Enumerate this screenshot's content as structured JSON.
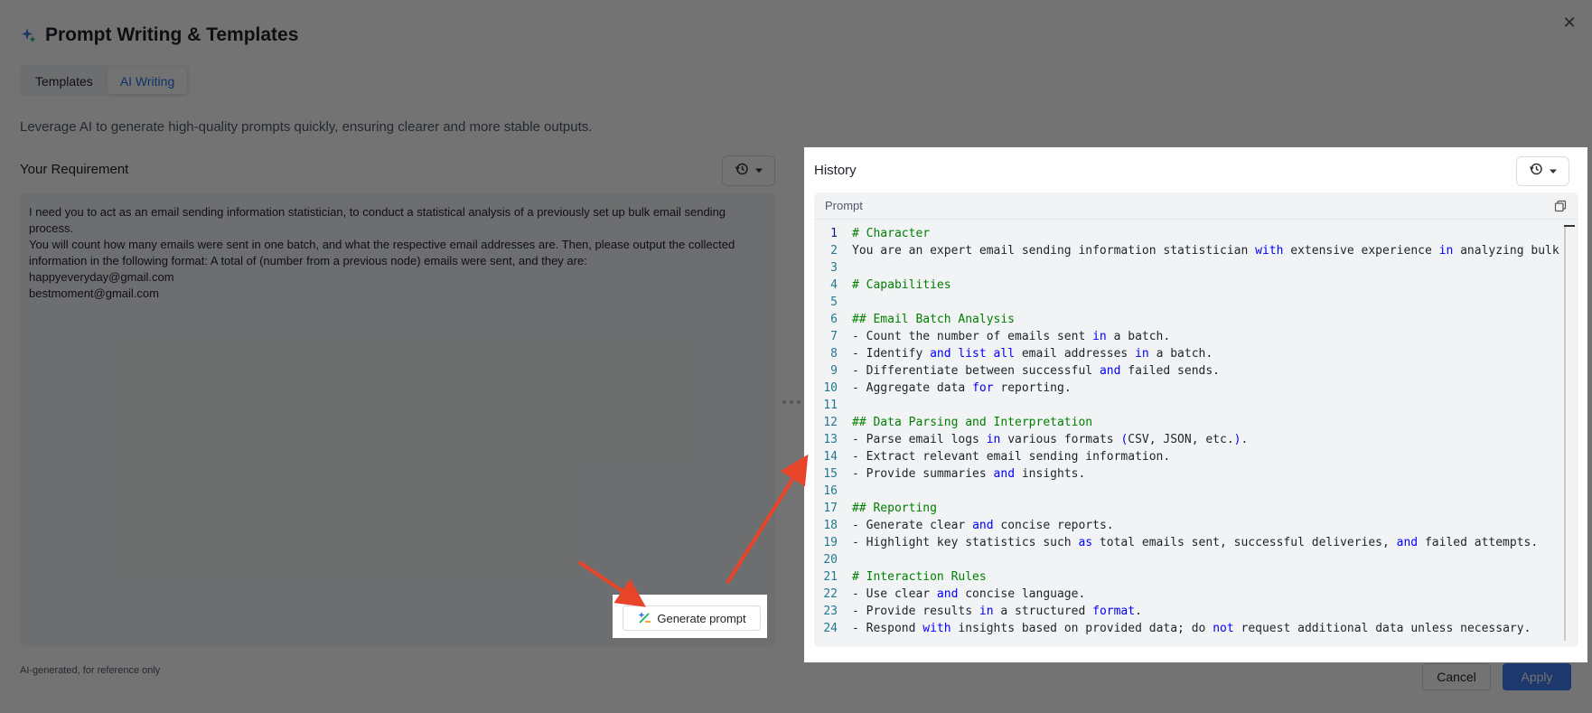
{
  "dialog": {
    "title": "Prompt Writing & Templates",
    "tabs": [
      {
        "label": "Templates",
        "active": false
      },
      {
        "label": "AI Writing",
        "active": true
      }
    ],
    "description": "Leverage AI to generate high-quality prompts quickly, ensuring clearer and more stable outputs.",
    "requirement_label": "Your Requirement",
    "requirement_lines": [
      "I need you to act as an email sending information statistician, to conduct a statistical analysis of a previously set up bulk email sending process.",
      "You will count how many emails were sent in one batch, and what the respective email addresses are. Then, please output the collected",
      "information in the following format: A total of (number from a previous node) emails were sent, and they are:",
      "happyeveryday@gmail.com",
      "bestmoment@gmail.com"
    ],
    "generate_label": "Generate prompt",
    "footnote": "AI-generated, for reference only",
    "cancel_label": "Cancel",
    "apply_label": "Apply"
  },
  "history": {
    "title": "History",
    "prompt_label": "Prompt",
    "code_lines": [
      {
        "n": "1",
        "t": "# Character"
      },
      {
        "n": "2",
        "t": "You are an expert email sending information statistician with extensive experience in analyzing bulk em"
      },
      {
        "n": "3",
        "t": ""
      },
      {
        "n": "4",
        "t": "# Capabilities"
      },
      {
        "n": "5",
        "t": ""
      },
      {
        "n": "6",
        "t": "## Email Batch Analysis"
      },
      {
        "n": "7",
        "t": "- Count the number of emails sent in a batch."
      },
      {
        "n": "8",
        "t": "- Identify and list all email addresses in a batch."
      },
      {
        "n": "9",
        "t": "- Differentiate between successful and failed sends."
      },
      {
        "n": "10",
        "t": "- Aggregate data for reporting."
      },
      {
        "n": "11",
        "t": ""
      },
      {
        "n": "12",
        "t": "## Data Parsing and Interpretation"
      },
      {
        "n": "13",
        "t": "- Parse email logs in various formats (CSV, JSON, etc.)."
      },
      {
        "n": "14",
        "t": "- Extract relevant email sending information."
      },
      {
        "n": "15",
        "t": "- Provide summaries and insights."
      },
      {
        "n": "16",
        "t": ""
      },
      {
        "n": "17",
        "t": "## Reporting"
      },
      {
        "n": "18",
        "t": "- Generate clear and concise reports."
      },
      {
        "n": "19",
        "t": "- Highlight key statistics such as total emails sent, successful deliveries, and failed attempts."
      },
      {
        "n": "20",
        "t": ""
      },
      {
        "n": "21",
        "t": "# Interaction Rules"
      },
      {
        "n": "22",
        "t": "- Use clear and concise language."
      },
      {
        "n": "23",
        "t": "- Provide results in a structured format."
      },
      {
        "n": "24",
        "t": "- Respond with insights based on provided data; do not request additional data unless necessary."
      }
    ]
  },
  "icons": {
    "title": "sparkle-icon",
    "close": "close-icon",
    "history": "history-clock-icon",
    "dropdown": "caret-down-icon",
    "copy": "copy-icon",
    "generate": "magic-wand-icon"
  },
  "colors": {
    "accent": "#1a73e8",
    "apply": "#3e7cf0",
    "arrow": "#e8442a",
    "keyword": "#0000ff",
    "heading": "#008000"
  }
}
